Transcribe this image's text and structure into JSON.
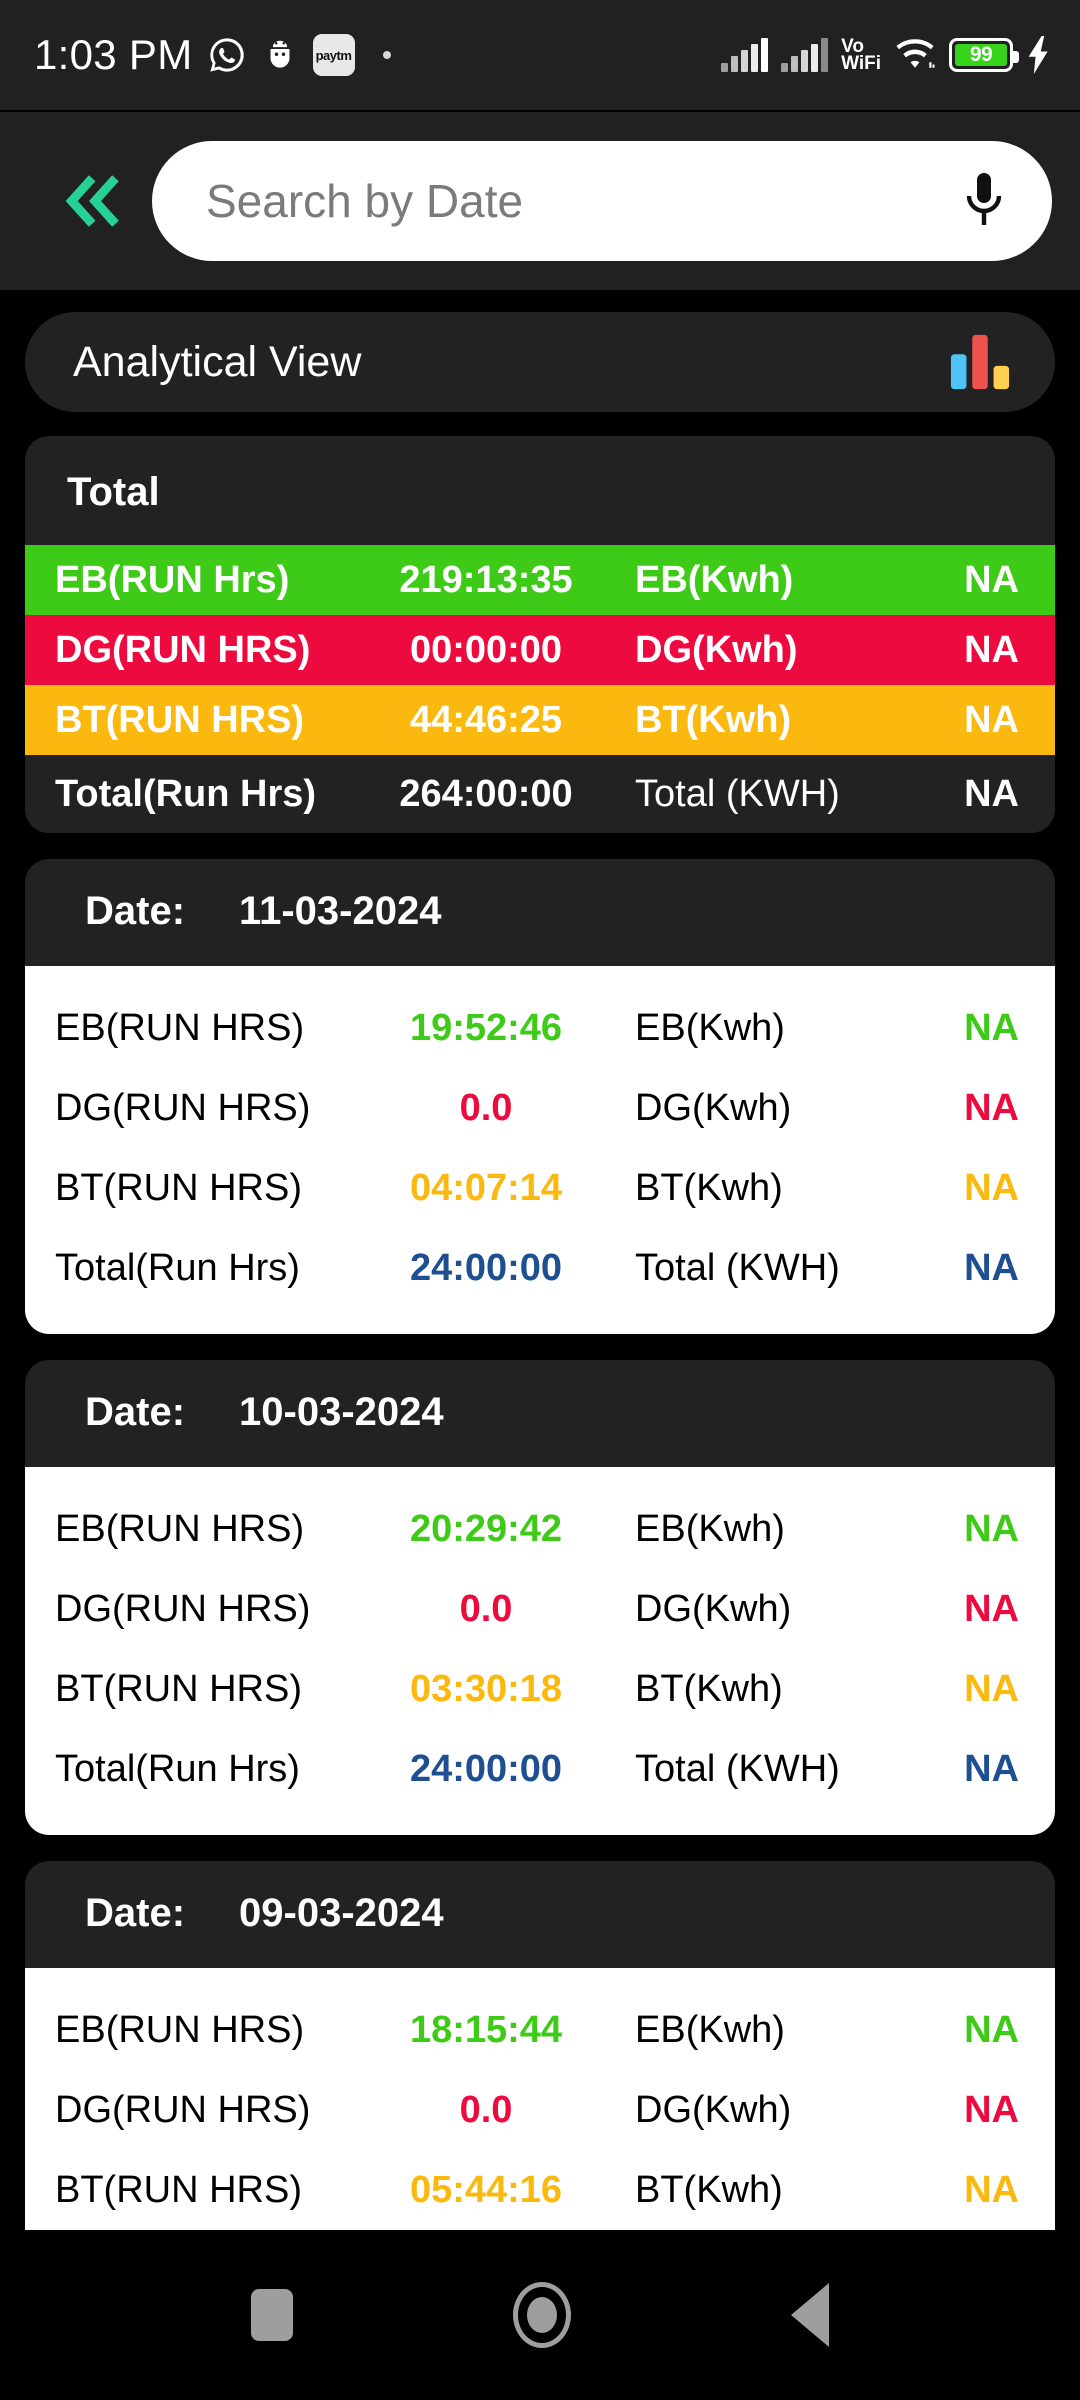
{
  "statusbar": {
    "clock": "1:03 PM",
    "app_icons": [
      "whatsapp-icon",
      "bug-droid-icon",
      "paytm-icon"
    ],
    "paytm_label": "paytm",
    "network_label_line1": "Vo",
    "network_label_line2": "WiFi",
    "battery_percent": "99",
    "battery_color": "#37d21a",
    "charging": true
  },
  "search": {
    "placeholder": "Search by Date",
    "value": "",
    "back_icon": "double-chevron-left-icon",
    "back_icon_color": "#26d196",
    "mic_icon": "microphone-icon"
  },
  "analytical": {
    "title": "Analytical View",
    "icon": "bar-chart-icon",
    "icon_colors": [
      "#4fc3f7",
      "#ef5350",
      "#ffd04f"
    ]
  },
  "total_card": {
    "heading": "Total",
    "rows": [
      {
        "label": "EB(RUN Hrs)",
        "value": "219:13:35",
        "unit_label": "EB(Kwh)",
        "unit_value": "NA",
        "bg": "#3dcb17",
        "fg": "#ffffff"
      },
      {
        "label": "DG(RUN HRS)",
        "value": "00:00:00",
        "unit_label": "DG(Kwh)",
        "unit_value": "NA",
        "bg": "#ec0a3e",
        "fg": "#ffffff"
      },
      {
        "label": "BT(RUN HRS)",
        "value": "44:46:25",
        "unit_label": "BT(Kwh)",
        "unit_value": "NA",
        "bg": "#fbb80e",
        "fg": "#ffffff"
      },
      {
        "label": "Total(Run Hrs)",
        "value": "264:00:00",
        "unit_label": "Total (KWH)",
        "unit_value": "NA",
        "bg": "#222222",
        "fg": "#ffffff"
      }
    ]
  },
  "date_label": "Date:",
  "colors": {
    "eb": "#3dcb17",
    "dg": "#ec0a3e",
    "bt": "#fbb80e",
    "total": "#1d4f91",
    "page_bg": "#000000",
    "card_dark": "#222222"
  },
  "day_cards": [
    {
      "date": "11-03-2024",
      "rows": [
        {
          "label": "EB(RUN HRS)",
          "value": "19:52:46",
          "unit_label": "EB(Kwh)",
          "unit_value": "NA",
          "color": "#3dcb17"
        },
        {
          "label": "DG(RUN HRS)",
          "value": "0.0",
          "unit_label": "DG(Kwh)",
          "unit_value": "NA",
          "color": "#ec0a3e"
        },
        {
          "label": "BT(RUN HRS)",
          "value": "04:07:14",
          "unit_label": "BT(Kwh)",
          "unit_value": "NA",
          "color": "#fbb80e"
        },
        {
          "label": "Total(Run Hrs)",
          "value": "24:00:00",
          "unit_label": "Total (KWH)",
          "unit_value": "NA",
          "color": "#1d4f91"
        }
      ]
    },
    {
      "date": "10-03-2024",
      "rows": [
        {
          "label": "EB(RUN HRS)",
          "value": "20:29:42",
          "unit_label": "EB(Kwh)",
          "unit_value": "NA",
          "color": "#3dcb17"
        },
        {
          "label": "DG(RUN HRS)",
          "value": "0.0",
          "unit_label": "DG(Kwh)",
          "unit_value": "NA",
          "color": "#ec0a3e"
        },
        {
          "label": "BT(RUN HRS)",
          "value": "03:30:18",
          "unit_label": "BT(Kwh)",
          "unit_value": "NA",
          "color": "#fbb80e"
        },
        {
          "label": "Total(Run Hrs)",
          "value": "24:00:00",
          "unit_label": "Total (KWH)",
          "unit_value": "NA",
          "color": "#1d4f91"
        }
      ]
    },
    {
      "date": "09-03-2024",
      "rows": [
        {
          "label": "EB(RUN HRS)",
          "value": "18:15:44",
          "unit_label": "EB(Kwh)",
          "unit_value": "NA",
          "color": "#3dcb17"
        },
        {
          "label": "DG(RUN HRS)",
          "value": "0.0",
          "unit_label": "DG(Kwh)",
          "unit_value": "NA",
          "color": "#ec0a3e"
        },
        {
          "label": "BT(RUN HRS)",
          "value": "05:44:16",
          "unit_label": "BT(Kwh)",
          "unit_value": "NA",
          "color": "#fbb80e"
        }
      ]
    }
  ],
  "navbar": {
    "recents": "recents-square-icon",
    "home": "home-circle-icon",
    "back": "back-triangle-icon"
  }
}
